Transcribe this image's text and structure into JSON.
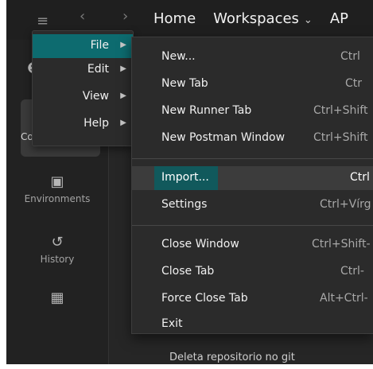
{
  "header": {
    "nav_items": [
      "Home",
      "Workspaces",
      "AP"
    ],
    "workspaces_chevron_icon": "chevron-down-icon"
  },
  "sidebar": {
    "active_label": "Co",
    "items": [
      {
        "label": "Environments",
        "icon": "environment-icon"
      },
      {
        "label": "History",
        "icon": "history-icon"
      },
      {
        "label": "",
        "icon": "add-widget-icon"
      }
    ]
  },
  "main_menu": {
    "items": [
      {
        "label": "File",
        "has_submenu": true
      },
      {
        "label": "Edit",
        "has_submenu": true
      },
      {
        "label": "View",
        "has_submenu": true
      },
      {
        "label": "Help",
        "has_submenu": true
      }
    ]
  },
  "file_menu": {
    "group1": [
      {
        "label": "New...",
        "shortcut": "Ctrl"
      },
      {
        "label": "New Tab",
        "shortcut": "Ctr"
      },
      {
        "label": "New Runner Tab",
        "shortcut": "Ctrl+Shift"
      },
      {
        "label": "New Postman Window",
        "shortcut": "Ctrl+Shift"
      }
    ],
    "group2": [
      {
        "label": "Import...",
        "shortcut": "Ctrl"
      },
      {
        "label": "Settings",
        "shortcut": "Ctrl+Vírg"
      }
    ],
    "group3": [
      {
        "label": "Close Window",
        "shortcut": "Ctrl+Shift-"
      },
      {
        "label": "Close Tab",
        "shortcut": "Ctrl-"
      },
      {
        "label": "Force Close Tab",
        "shortcut": "Alt+Ctrl-"
      },
      {
        "label": "Exit",
        "shortcut": ""
      }
    ]
  },
  "background_text": "Deleta repositorio no git"
}
